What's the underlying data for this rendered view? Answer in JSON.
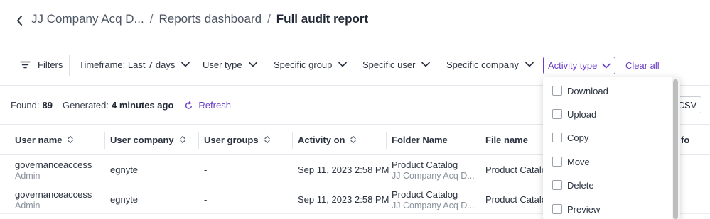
{
  "breadcrumb": {
    "items": [
      "JJ Company Acq D...",
      "Reports dashboard"
    ],
    "current": "Full audit report",
    "separator": "/"
  },
  "filters": {
    "filters_label": "Filters",
    "timeframe": "Timeframe: Last 7 days",
    "user_type": "User type",
    "specific_group": "Specific group",
    "specific_user": "Specific user",
    "specific_company": "Specific company",
    "activity_type": "Activity type",
    "clear_all": "Clear all"
  },
  "summary": {
    "found_label": "Found:",
    "found_value": "89",
    "generated_label": "Generated:",
    "generated_value": "4 minutes ago",
    "refresh": "Refresh",
    "csv": "CSV"
  },
  "table": {
    "columns": [
      "User name",
      "User company",
      "User groups",
      "Activity on",
      "Folder Name",
      "File name",
      "fo"
    ],
    "rows": [
      {
        "user_name": "governanceaccess",
        "user_role": "Admin",
        "company": "egnyte",
        "groups": "-",
        "activity_on": "Sep 11, 2023 2:58 PM",
        "folder_name": "Product Catalog",
        "folder_path": "JJ Company Acq D...",
        "file_name": "Product Catalo"
      },
      {
        "user_name": "governanceaccess",
        "user_role": "Admin",
        "company": "egnyte",
        "groups": "-",
        "activity_on": "Sep 11, 2023 2:58 PM",
        "folder_name": "Product Catalog",
        "folder_path": "JJ Company Acq D...",
        "file_name": "Product Catalo"
      }
    ]
  },
  "activity_dropdown": {
    "options": [
      "Download",
      "Upload",
      "Copy",
      "Move",
      "Delete",
      "Preview"
    ]
  },
  "colors": {
    "accent": "#6a3fc7",
    "text": "#1f2733",
    "muted": "#8a929c",
    "border": "#e5e8ec"
  }
}
